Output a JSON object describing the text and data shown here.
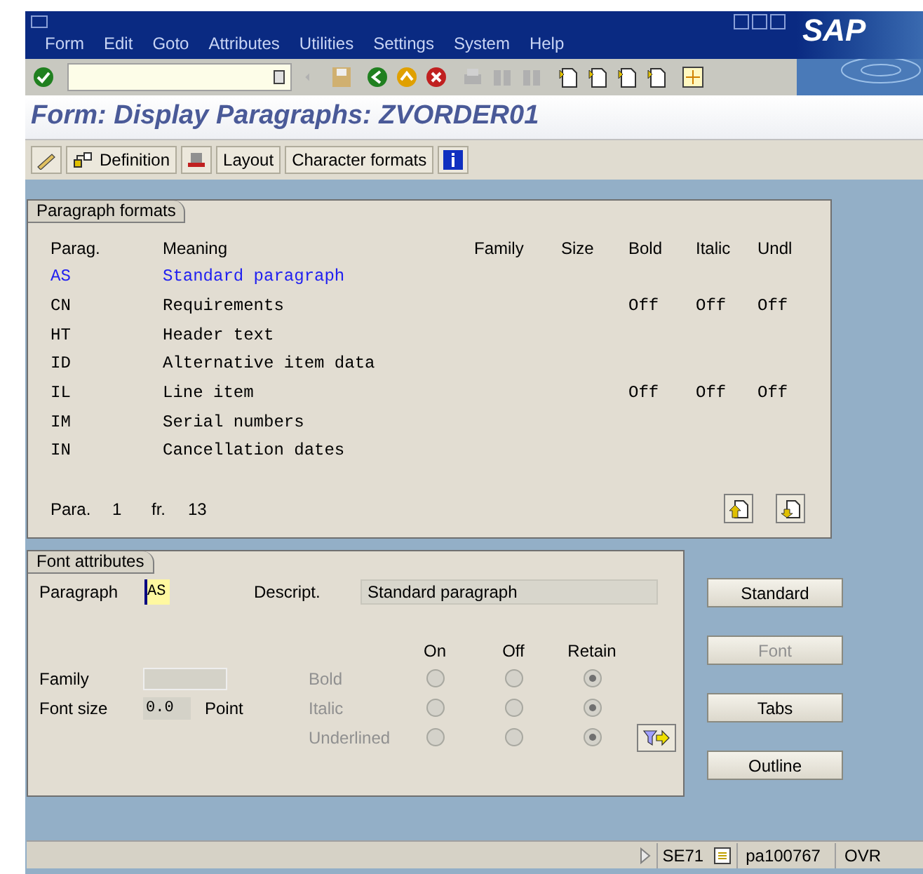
{
  "menu": [
    "Form",
    "Edit",
    "Goto",
    "Attributes",
    "Utilities",
    "Settings",
    "System",
    "Help"
  ],
  "logo": "SAP",
  "title": "Form: Display Paragraphs: ZVORDER01",
  "app_toolbar": [
    "Definition",
    "Layout",
    "Character formats"
  ],
  "paragraph_formats": {
    "title": "Paragraph formats",
    "columns": [
      "Parag.",
      "Meaning",
      "Family",
      "Size",
      "Bold",
      "Italic",
      "Undl"
    ],
    "rows": [
      {
        "parag": "AS",
        "meaning": "Standard paragraph",
        "selected": true
      },
      {
        "parag": "CN",
        "meaning": "Requirements",
        "bold": "Off",
        "italic": "Off",
        "undl": "Off",
        "selected": false
      },
      {
        "parag": "HT",
        "meaning": "Header text",
        "selected": false
      },
      {
        "parag": "ID",
        "meaning": "Alternative item data",
        "selected": false
      },
      {
        "parag": "IL",
        "meaning": "Line item",
        "bold": "Off",
        "italic": "Off",
        "undl": "Off",
        "selected": false
      },
      {
        "parag": "IM",
        "meaning": "Serial numbers",
        "selected": false
      },
      {
        "parag": "IN",
        "meaning": "Cancellation dates",
        "selected": false
      }
    ],
    "footer": {
      "label": "Para.",
      "current": "1",
      "of_label": "fr.",
      "total": "13"
    }
  },
  "font_attributes": {
    "title": "Font attributes",
    "paragraph_label": "Paragraph",
    "paragraph_value": "AS",
    "descript_label": "Descript.",
    "descript_value": "Standard paragraph",
    "columns": [
      "On",
      "Off",
      "Retain"
    ],
    "family_label": "Family",
    "font_size_label": "Font size",
    "font_size_value": "0.0",
    "unit": "Point",
    "styles": [
      {
        "label": "Bold",
        "disabled": true,
        "options": [
          {
            "selected": false
          },
          {
            "selected": false
          },
          {
            "selected": true
          }
        ]
      },
      {
        "label": "Italic",
        "disabled": true,
        "options": [
          {
            "selected": false
          },
          {
            "selected": false
          },
          {
            "selected": true
          }
        ]
      },
      {
        "label": "Underlined",
        "disabled": true,
        "options": [
          {
            "selected": false
          },
          {
            "selected": false
          },
          {
            "selected": true
          }
        ]
      }
    ]
  },
  "side_buttons": [
    {
      "label": "Standard",
      "disabled": false
    },
    {
      "label": "Font",
      "disabled": true
    },
    {
      "label": "Tabs",
      "disabled": false
    },
    {
      "label": "Outline",
      "disabled": false
    }
  ],
  "status": {
    "code": "SE71",
    "server": "pa100767",
    "mode": "OVR"
  }
}
